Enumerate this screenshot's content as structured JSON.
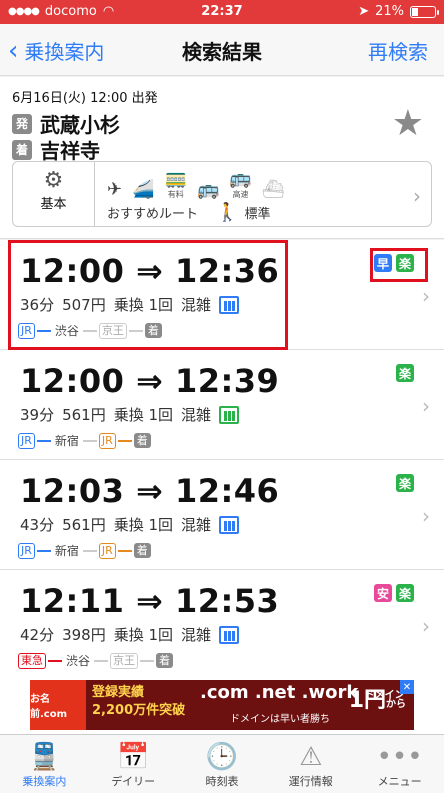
{
  "status": {
    "carrier": "docomo",
    "time": "22:37",
    "battery": "21%"
  },
  "nav": {
    "back": "乗換案内",
    "title": "検索結果",
    "research": "再検索"
  },
  "summary": {
    "date": "6月16日(火) 12:00 出発",
    "from_tag": "発",
    "from": "武蔵小杉",
    "to_tag": "着",
    "to": "吉祥寺",
    "base_label": "基本",
    "route_type": "おすすめルート",
    "walk_speed": "標準",
    "express_label": "有料",
    "ferry_label": "高速"
  },
  "routes": [
    {
      "times": "12:00 ⇒ 12:36",
      "duration": "36分",
      "fare": "507円",
      "transfer": "乗換 1回",
      "crowd": "混雑",
      "badges": [
        {
          "text": "早",
          "color": "#2f7cf6"
        },
        {
          "text": "楽",
          "color": "#2cb24a"
        }
      ],
      "path": [
        {
          "t": "JR",
          "c": "#2f7cf6"
        },
        {
          "s": "渋谷"
        },
        {
          "t": "京王",
          "c": "#cccccc"
        }
      ]
    },
    {
      "times": "12:00 ⇒ 12:39",
      "duration": "39分",
      "fare": "561円",
      "transfer": "乗換 1回",
      "crowd": "混雑",
      "badges": [
        {
          "text": "楽",
          "color": "#2cb24a"
        }
      ],
      "path": [
        {
          "t": "JR",
          "c": "#2f7cf6"
        },
        {
          "s": "新宿"
        },
        {
          "t": "JR",
          "c": "#e58a1e"
        }
      ]
    },
    {
      "times": "12:03 ⇒ 12:46",
      "duration": "43分",
      "fare": "561円",
      "transfer": "乗換 1回",
      "crowd": "混雑",
      "badges": [
        {
          "text": "楽",
          "color": "#2cb24a"
        }
      ],
      "path": [
        {
          "t": "JR",
          "c": "#2f7cf6"
        },
        {
          "s": "新宿"
        },
        {
          "t": "JR",
          "c": "#e58a1e"
        }
      ]
    },
    {
      "times": "12:11 ⇒ 12:53",
      "duration": "42分",
      "fare": "398円",
      "transfer": "乗換 1回",
      "crowd": "混雑",
      "badges": [
        {
          "text": "安",
          "color": "#e84a9a"
        },
        {
          "text": "楽",
          "color": "#2cb24a"
        }
      ],
      "path": [
        {
          "t": "東急",
          "c": "#e0101e"
        },
        {
          "s": "渋谷"
        },
        {
          "t": "京王",
          "c": "#cccccc"
        }
      ]
    }
  ],
  "dest_tag": "着",
  "ad": {
    "logo": "お名前.com",
    "line1": "登録実績",
    "line2": "2,200万件突破",
    "domains": ".com .net .work",
    "domain_label": "ドメイン",
    "price": "1円",
    "price_suffix": "から",
    "sub": "ドメインは早い者勝ち"
  },
  "tabs": [
    {
      "label": "乗換案内",
      "active": true
    },
    {
      "label": "デイリー"
    },
    {
      "label": "時刻表"
    },
    {
      "label": "運行情報"
    },
    {
      "label": "メニュー"
    }
  ]
}
